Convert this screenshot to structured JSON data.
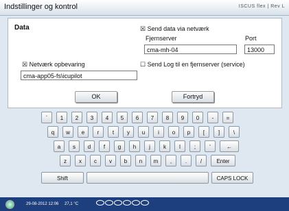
{
  "window": {
    "title": "Indstillinger og kontrol",
    "brand": "ISCUS flex | Rev L"
  },
  "data_section": {
    "heading": "Data"
  },
  "network": {
    "send_checkbox": "☒",
    "send_label": "Send data via netværk",
    "server_label": "Fjernserver",
    "server_value": "cma-mh-04",
    "port_label": "Port",
    "port_value": "13000",
    "log_checkbox": "☐",
    "log_label": "Send Log til en fjernserver (service)"
  },
  "storage": {
    "checkbox": "☒",
    "label": "Netværk opbevaring",
    "path_value": "cma-app05-fs\\icupilot"
  },
  "buttons": {
    "ok": "OK",
    "cancel": "Fortryd"
  },
  "keyboard": {
    "row1": [
      "`",
      "1",
      "2",
      "3",
      "4",
      "5",
      "6",
      "7",
      "8",
      "9",
      "0",
      "-",
      "="
    ],
    "row2": [
      "q",
      "w",
      "e",
      "r",
      "t",
      "y",
      "u",
      "i",
      "o",
      "p",
      "[",
      "]",
      "\\"
    ],
    "row3": [
      "a",
      "s",
      "d",
      "f",
      "g",
      "h",
      "j",
      "k",
      "l",
      ";",
      "'",
      "←"
    ],
    "row4": [
      "z",
      "x",
      "c",
      "v",
      "b",
      "n",
      "m",
      ",",
      ".",
      "/",
      "Enter"
    ],
    "shift": "Shift",
    "caps": "CAPS LOCK"
  },
  "status": {
    "datetime": "29-08-2012 12:06",
    "temperature": "27,1 °C"
  },
  "colors": {
    "statusbar": "#1e3f7e",
    "background": "#dfe8f1"
  }
}
